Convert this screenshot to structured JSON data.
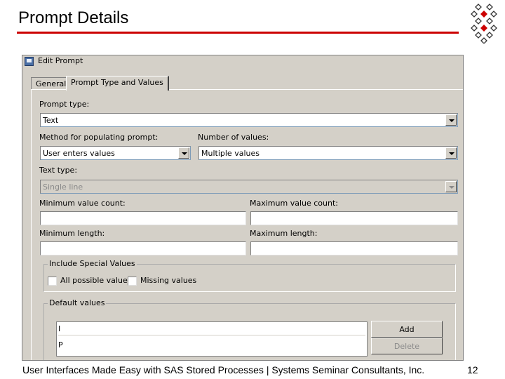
{
  "slide": {
    "title": "Prompt Details",
    "footer": "User Interfaces Made Easy with SAS Stored Processes  |  Systems Seminar Consultants, Inc.",
    "page_number": "12"
  },
  "dialog": {
    "title": "Edit Prompt",
    "tabs": [
      {
        "label": "General",
        "active": false
      },
      {
        "label": "Prompt Type and Values",
        "active": true
      }
    ],
    "prompt_type": {
      "label": "Prompt type:",
      "value": "Text"
    },
    "method": {
      "label": "Method for populating prompt:",
      "value": "User enters values"
    },
    "number_of_values": {
      "label": "Number of values:",
      "value": "Multiple values"
    },
    "text_type": {
      "label": "Text type:",
      "value": "Single line",
      "disabled": true
    },
    "min_value_count": {
      "label": "Minimum value count:",
      "value": ""
    },
    "max_value_count": {
      "label": "Maximum value count:",
      "value": ""
    },
    "min_length": {
      "label": "Minimum length:",
      "value": ""
    },
    "max_length": {
      "label": "Maximum length:",
      "value": ""
    },
    "special_values": {
      "title": "Include Special Values",
      "options": [
        {
          "label": "All possible values",
          "checked": false
        },
        {
          "label": "Missing values",
          "checked": false
        }
      ]
    },
    "default_values": {
      "title": "Default values",
      "items": [
        "I",
        "P"
      ],
      "add_label": "Add",
      "delete_label": "Delete"
    }
  },
  "colors": {
    "title_rule": "#cc0000",
    "dialog_face": "#d4d0c8",
    "logo_red": "#cc0000"
  },
  "icons": [
    "diamond-logo-icon",
    "edit-prompt-window-icon",
    "dropdown-arrow-icon"
  ]
}
